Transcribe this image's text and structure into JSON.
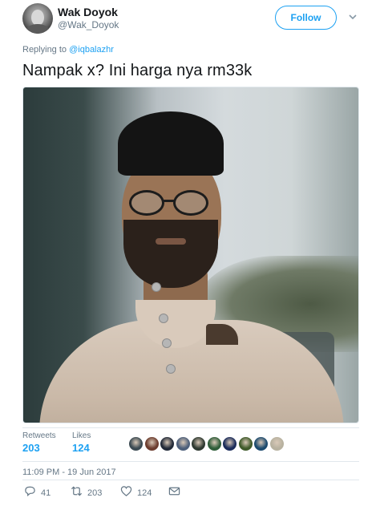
{
  "tweet": {
    "author": {
      "name": "Wak Doyok",
      "handle": "@Wak_Doyok"
    },
    "follow_label": "Follow",
    "replying_to_prefix": "Replying to ",
    "replying_to_handle": "@iqbalazhr",
    "text": "Nampak x? Ini harga nya rm33k",
    "stats": {
      "retweets_label": "Retweets",
      "retweets_value": "203",
      "likes_label": "Likes",
      "likes_value": "124"
    },
    "timestamp": "11:09 PM - 19 Jun 2017",
    "actions": {
      "reply_count": "41",
      "retweet_count": "203",
      "like_count": "124"
    }
  },
  "colors": {
    "accent": "#1da1f2",
    "muted": "#657786",
    "text": "#14171a"
  },
  "liker_avatars": [
    "#3b4a52",
    "#6c3c2e",
    "#222a38",
    "#4d5f7a",
    "#2f3a31",
    "#2f5d39",
    "#1b2c5a",
    "#3f5a2a",
    "#1c4a6e",
    "#b8b2a0"
  ]
}
